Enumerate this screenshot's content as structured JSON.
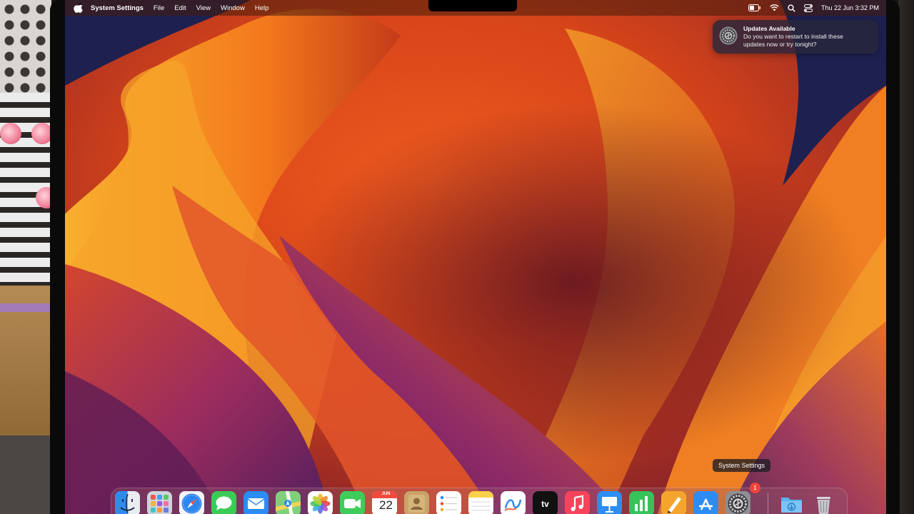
{
  "menubar": {
    "app_name": "System Settings",
    "menus": [
      "File",
      "Edit",
      "View",
      "Window",
      "Help"
    ],
    "clock": "Thu 22 Jun  3:32 PM",
    "status_icons": [
      "battery-icon",
      "wifi-icon",
      "spotlight-search-icon",
      "control-center-icon"
    ]
  },
  "notification": {
    "icon": "system-settings-gear-icon",
    "title": "Updates Available",
    "body_line1": "Do you want to restart to install these",
    "body_line2": "updates now or try tonight?"
  },
  "dock": {
    "tooltip": "System Settings",
    "calendar_month": "JUN",
    "calendar_day": "22",
    "settings_badge": "1",
    "apps": [
      "Finder",
      "Launchpad",
      "Safari",
      "Messages",
      "Mail",
      "Maps",
      "Photos",
      "FaceTime",
      "Calendar",
      "Contacts",
      "Reminders",
      "Notes",
      "Freeform",
      "TV",
      "Music",
      "Keynote",
      "Numbers",
      "Pages",
      "App Store",
      "System Settings",
      "Downloads",
      "Trash"
    ]
  },
  "colors": {
    "wallpaper_orange": "#f07a1e",
    "wallpaper_deep": "#b8301a",
    "wallpaper_purple": "#8a2f6a",
    "wallpaper_navy": "#1c1f4a",
    "badge_red": "#f0453a"
  }
}
